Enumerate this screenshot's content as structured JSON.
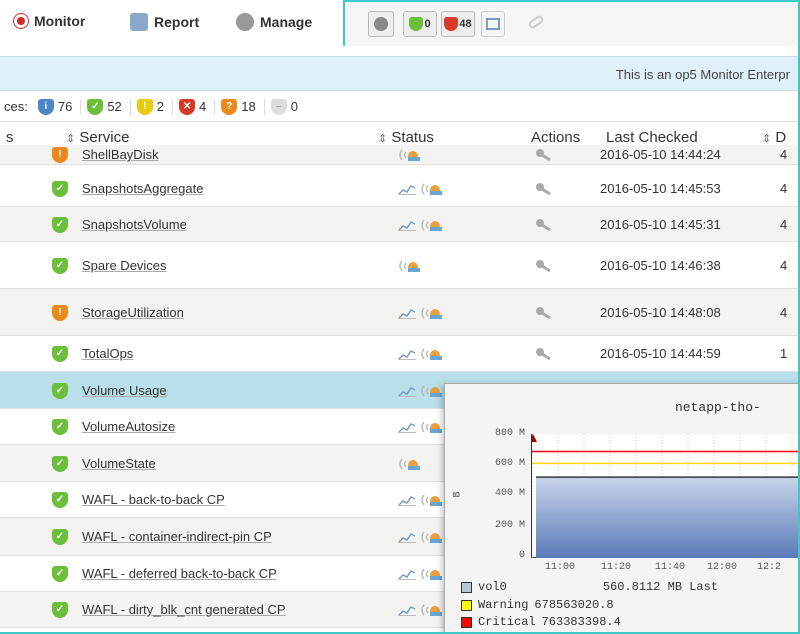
{
  "nav": {
    "monitor": "Monitor",
    "report": "Report",
    "manage": "Manage",
    "toolbar_ok_count": "0",
    "toolbar_crit_count": "48"
  },
  "banner": {
    "text": "This is an op5 Monitor Enterpr"
  },
  "summary": {
    "prefix": "ces:",
    "counts": [
      {
        "value": "76",
        "color": "#4a86c8"
      },
      {
        "value": "52",
        "color": "#6bbf3a"
      },
      {
        "value": "2",
        "color": "#e8cc10"
      },
      {
        "value": "4",
        "color": "#d83a2a"
      },
      {
        "value": "18",
        "color": "#eb8a1c"
      },
      {
        "value": "0",
        "color": "#dddddd"
      }
    ]
  },
  "table": {
    "headers": {
      "left_fragment": "s",
      "service": "Service",
      "status": "Status",
      "actions": "Actions",
      "last_checked": "Last Checked",
      "right_fragment": "D"
    },
    "rows": [
      {
        "service": "ShellBayDisk",
        "state": "warning",
        "time": "2016-05-10 14:44:24",
        "edge": "4"
      },
      {
        "service": "SnapshotsAggregate",
        "state": "ok",
        "time": "2016-05-10 14:45:53",
        "edge": "4"
      },
      {
        "service": "SnapshotsVolume",
        "state": "ok",
        "time": "2016-05-10 14:45:31",
        "edge": "4"
      },
      {
        "service": "Spare Devices",
        "state": "ok",
        "time": "2016-05-10 14:46:38",
        "edge": "4"
      },
      {
        "service": "StorageUtilization",
        "state": "warning",
        "time": "2016-05-10 14:48:08",
        "edge": "4"
      },
      {
        "service": "TotalOps",
        "state": "ok",
        "time": "2016-05-10 14:44:59",
        "edge": "1"
      },
      {
        "service": "Volume Usage",
        "state": "ok",
        "time": "",
        "edge": ""
      },
      {
        "service": "VolumeAutosize",
        "state": "ok",
        "time": "",
        "edge": ""
      },
      {
        "service": "VolumeState",
        "state": "ok",
        "time": "",
        "edge": ""
      },
      {
        "service": "WAFL - back-to-back CP",
        "state": "ok",
        "time": "",
        "edge": ""
      },
      {
        "service": "WAFL - container-indirect-pin CP",
        "state": "ok",
        "time": "",
        "edge": ""
      },
      {
        "service": "WAFL - deferred back-to-back CP",
        "state": "ok",
        "time": "",
        "edge": ""
      },
      {
        "service": "WAFL - dirty_blk_cnt generated CP",
        "state": "ok",
        "time": "",
        "edge": ""
      }
    ]
  },
  "popup": {
    "title": "netapp-tho-",
    "y_unit": "B",
    "y_ticks": [
      "800 M",
      "600 M",
      "400 M",
      "200 M",
      "0"
    ],
    "x_ticks": [
      "11:00",
      "11:20",
      "11:40",
      "12:00",
      "12:2"
    ],
    "legend": [
      {
        "label": "vol0",
        "value": "560.8112 MB Last",
        "color": "#b8c4d8"
      },
      {
        "label": "Warning",
        "value": "678563020.8",
        "color": "#ffff00"
      },
      {
        "label": "Critical",
        "value": "763383398.4",
        "color": "#ff0000"
      }
    ],
    "series_fill": "#5a7ab8",
    "warning_color": "#ffd700",
    "critical_color": "#ff0000"
  },
  "chart_data": {
    "type": "area",
    "title": "netapp-tho-",
    "x": [
      "11:00",
      "11:20",
      "11:40",
      "12:00",
      "12:2"
    ],
    "ylabel": "B",
    "ylim": [
      0,
      800000000
    ],
    "series": [
      {
        "name": "vol0",
        "values": [
          580000000,
          580000000,
          580000000,
          580000000,
          580000000
        ]
      },
      {
        "name": "Warning",
        "values": [
          678563020.8,
          678563020.8,
          678563020.8,
          678563020.8,
          678563020.8
        ]
      },
      {
        "name": "Critical",
        "values": [
          763383398.4,
          763383398.4,
          763383398.4,
          763383398.4,
          763383398.4
        ]
      }
    ]
  }
}
